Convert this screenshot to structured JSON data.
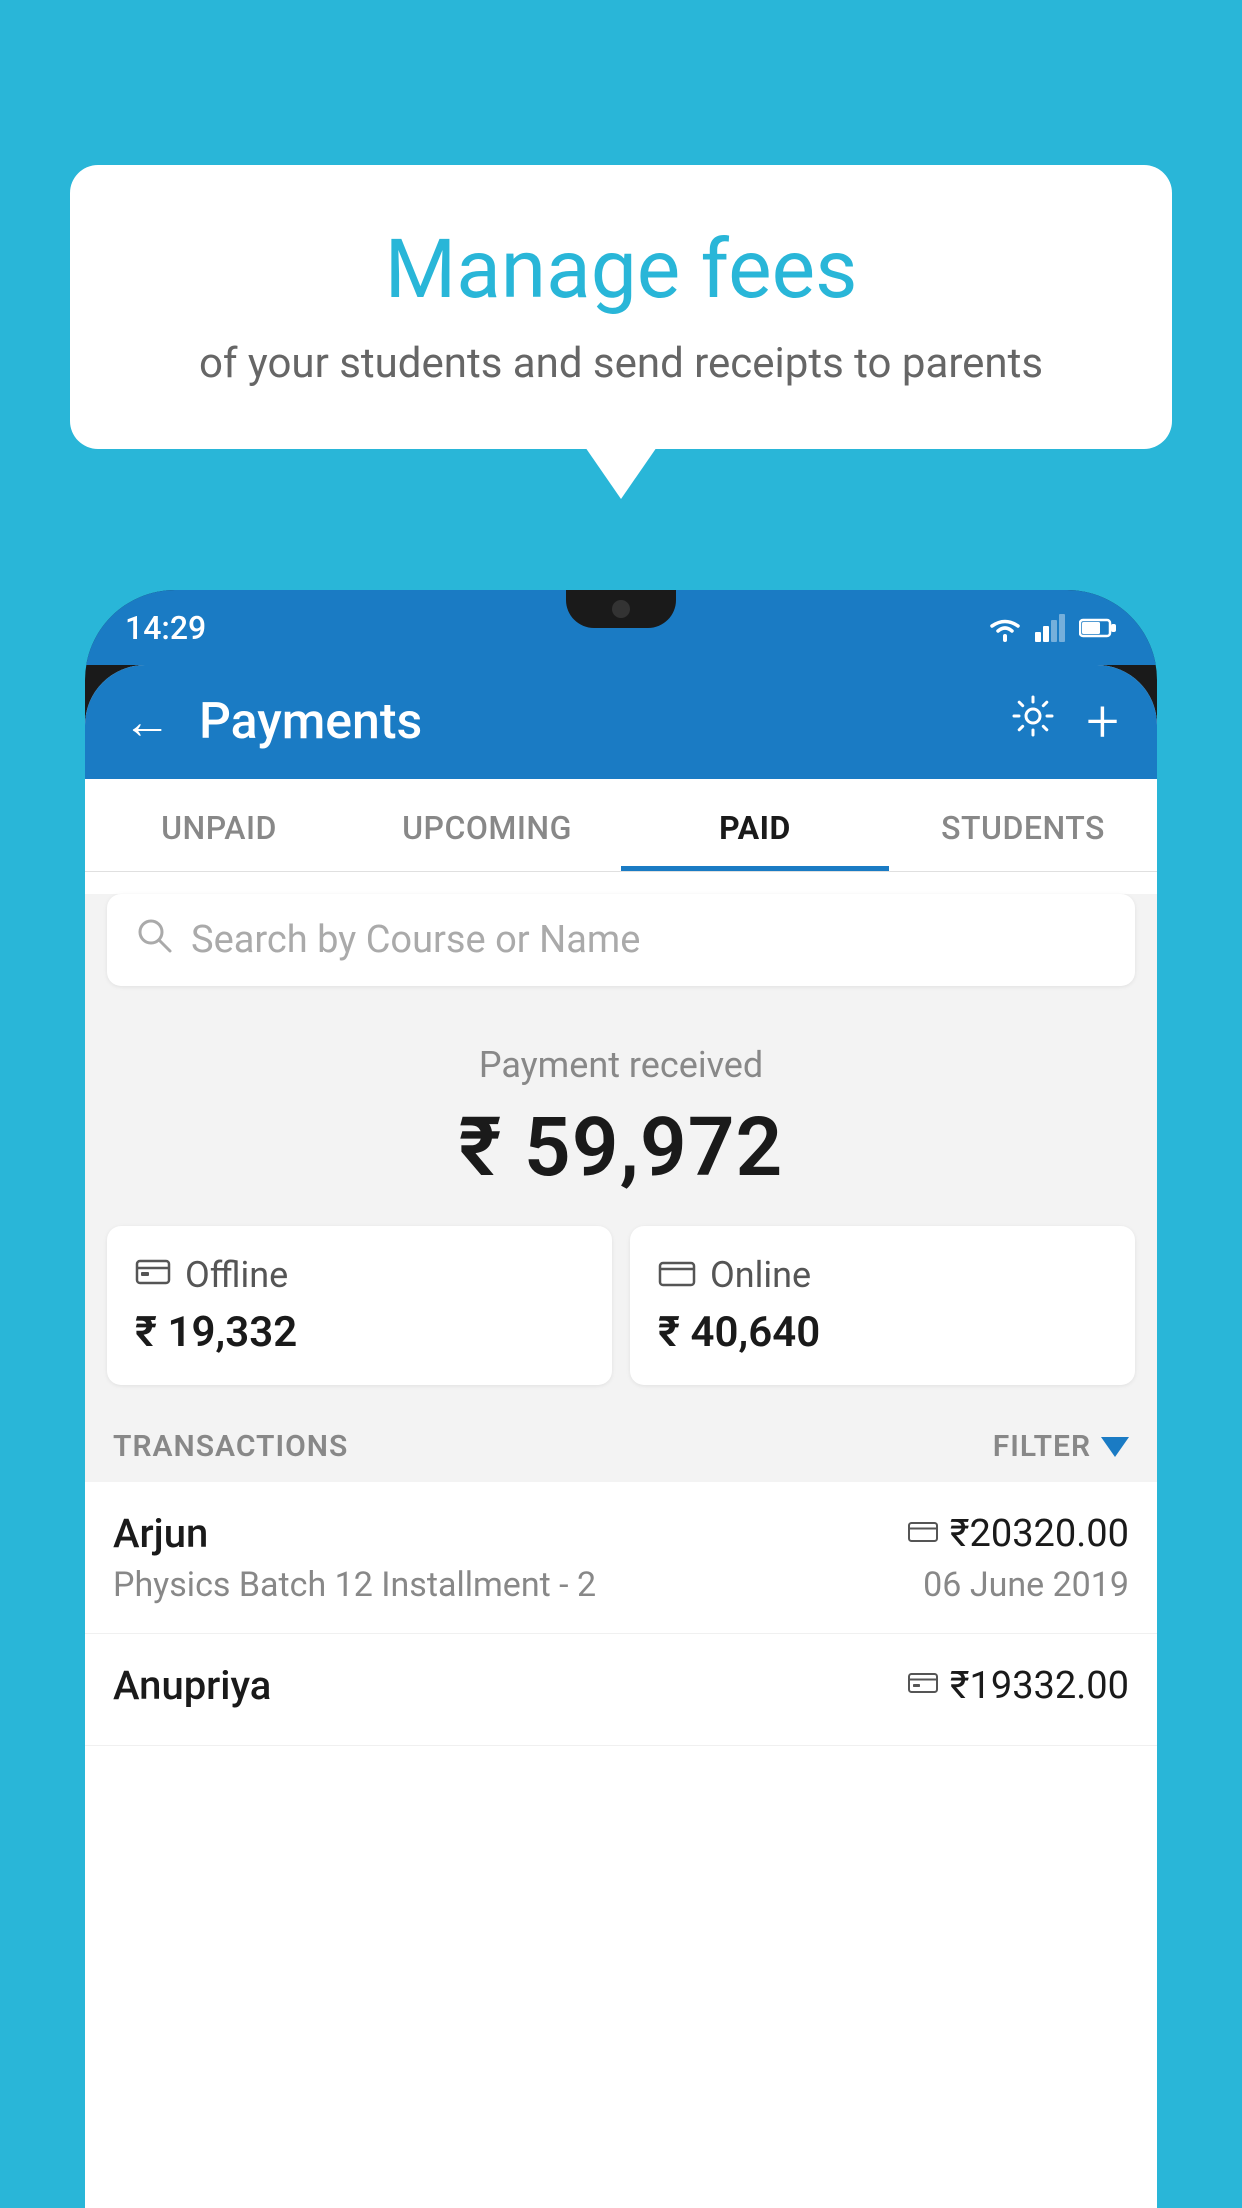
{
  "background_color": "#29b6d8",
  "bubble": {
    "title": "Manage fees",
    "subtitle": "of your students and send receipts to parents"
  },
  "status_bar": {
    "time": "14:29"
  },
  "header": {
    "title": "Payments",
    "back_label": "←",
    "settings_label": "⚙",
    "add_label": "+"
  },
  "tabs": [
    {
      "id": "unpaid",
      "label": "UNPAID",
      "active": false
    },
    {
      "id": "upcoming",
      "label": "UPCOMING",
      "active": false
    },
    {
      "id": "paid",
      "label": "PAID",
      "active": true
    },
    {
      "id": "students",
      "label": "STUDENTS",
      "active": false
    }
  ],
  "search": {
    "placeholder": "Search by Course or Name"
  },
  "payment_summary": {
    "label": "Payment received",
    "amount": "₹ 59,972"
  },
  "payment_cards": [
    {
      "type": "Offline",
      "amount": "₹ 19,332",
      "icon": "offline"
    },
    {
      "type": "Online",
      "amount": "₹ 40,640",
      "icon": "online"
    }
  ],
  "transactions_label": "TRANSACTIONS",
  "filter_label": "FILTER",
  "transactions": [
    {
      "name": "Arjun",
      "course": "Physics Batch 12 Installment - 2",
      "amount": "₹20320.00",
      "date": "06 June 2019",
      "icon": "online"
    },
    {
      "name": "Anupriya",
      "course": "",
      "amount": "₹19332.00",
      "date": "",
      "icon": "offline"
    }
  ]
}
